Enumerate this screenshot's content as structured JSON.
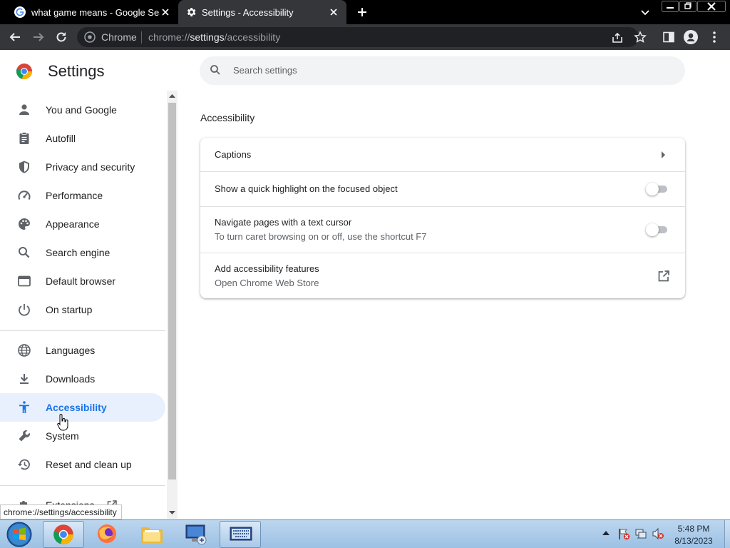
{
  "browser": {
    "tabs": [
      {
        "title": "what game means - Google Search",
        "active": false
      },
      {
        "title": "Settings - Accessibility",
        "active": true
      }
    ],
    "omnibox": {
      "site_label": "Chrome",
      "url_prefix": "chrome://",
      "url_host": "settings",
      "url_path": "/accessibility"
    }
  },
  "settings": {
    "title": "Settings",
    "search_placeholder": "Search settings",
    "nav": [
      {
        "label": "You and Google",
        "icon": "person-icon"
      },
      {
        "label": "Autofill",
        "icon": "clipboard-icon"
      },
      {
        "label": "Privacy and security",
        "icon": "shield-icon"
      },
      {
        "label": "Performance",
        "icon": "speedometer-icon"
      },
      {
        "label": "Appearance",
        "icon": "palette-icon"
      },
      {
        "label": "Search engine",
        "icon": "search-icon"
      },
      {
        "label": "Default browser",
        "icon": "browser-window-icon"
      },
      {
        "label": "On startup",
        "icon": "power-icon"
      },
      {
        "label": "Languages",
        "icon": "globe-icon"
      },
      {
        "label": "Downloads",
        "icon": "download-icon"
      },
      {
        "label": "Accessibility",
        "icon": "accessibility-icon",
        "active": true
      },
      {
        "label": "System",
        "icon": "wrench-icon"
      },
      {
        "label": "Reset and clean up",
        "icon": "restore-icon"
      },
      {
        "label": "Extensions",
        "icon": "puzzle-icon"
      }
    ],
    "section_title": "Accessibility",
    "rows": {
      "captions": {
        "label": "Captions"
      },
      "highlight": {
        "label": "Show a quick highlight on the focused object",
        "enabled": false
      },
      "caret": {
        "label": "Navigate pages with a text cursor",
        "sublabel": "To turn caret browsing on or off, use the shortcut F7",
        "enabled": false
      },
      "add_features": {
        "label": "Add accessibility features",
        "sublabel": "Open Chrome Web Store"
      }
    }
  },
  "status_bubble": "chrome://settings/accessibility",
  "taskbar": {
    "clock_time": "5:48 PM",
    "clock_date": "8/13/2023"
  },
  "colors": {
    "accent": "#1a73e8",
    "active_nav_bg": "#e8f0fe",
    "tab_active_bg": "#35363a"
  }
}
